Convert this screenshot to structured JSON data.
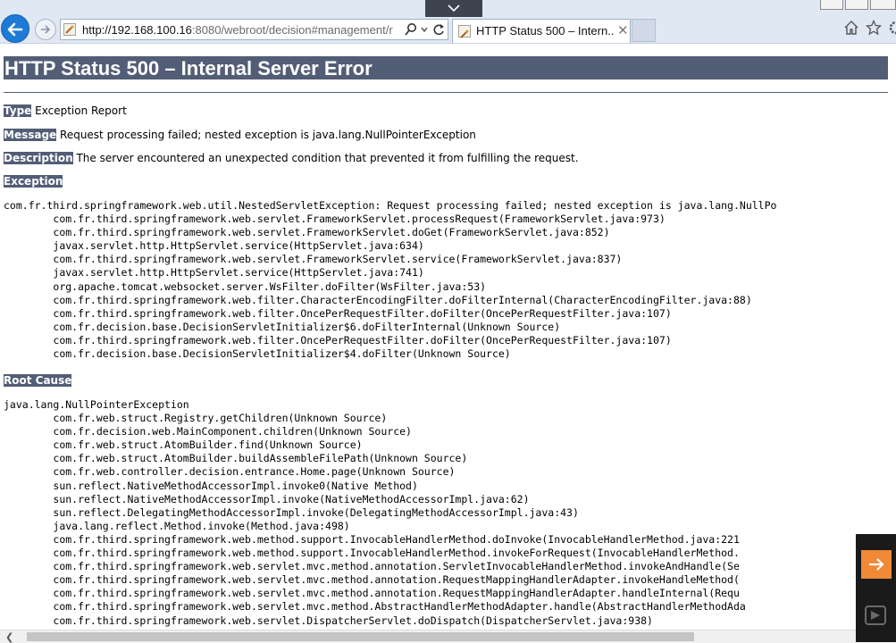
{
  "browser": {
    "url_host": "http://192.168.100.16",
    "url_rest": ":8080/webroot/decision#management/r",
    "tab_title": "HTTP Status 500 – Intern...",
    "tab_close": "✕"
  },
  "page": {
    "heading": "HTTP Status 500 – Internal Server Error",
    "type_label": "Type",
    "type_value": " Exception Report",
    "message_label": "Message",
    "message_value": " Request processing failed; nested exception is java.lang.NullPointerException",
    "description_label": "Description",
    "description_value": " The server encountered an unexpected condition that prevented it from fulfilling the request.",
    "exception_label": "Exception",
    "exception_trace": "com.fr.third.springframework.web.util.NestedServletException: Request processing failed; nested exception is java.lang.NullPo\n\tcom.fr.third.springframework.web.servlet.FrameworkServlet.processRequest(FrameworkServlet.java:973)\n\tcom.fr.third.springframework.web.servlet.FrameworkServlet.doGet(FrameworkServlet.java:852)\n\tjavax.servlet.http.HttpServlet.service(HttpServlet.java:634)\n\tcom.fr.third.springframework.web.servlet.FrameworkServlet.service(FrameworkServlet.java:837)\n\tjavax.servlet.http.HttpServlet.service(HttpServlet.java:741)\n\torg.apache.tomcat.websocket.server.WsFilter.doFilter(WsFilter.java:53)\n\tcom.fr.third.springframework.web.filter.CharacterEncodingFilter.doFilterInternal(CharacterEncodingFilter.java:88)\n\tcom.fr.third.springframework.web.filter.OncePerRequestFilter.doFilter(OncePerRequestFilter.java:107)\n\tcom.fr.decision.base.DecisionServletInitializer$6.doFilterInternal(Unknown Source)\n\tcom.fr.third.springframework.web.filter.OncePerRequestFilter.doFilter(OncePerRequestFilter.java:107)\n\tcom.fr.decision.base.DecisionServletInitializer$4.doFilter(Unknown Source)",
    "root_cause_label": "Root Cause",
    "root_cause_trace": "java.lang.NullPointerException\n\tcom.fr.web.struct.Registry.getChildren(Unknown Source)\n\tcom.fr.decision.web.MainComponent.children(Unknown Source)\n\tcom.fr.web.struct.AtomBuilder.find(Unknown Source)\n\tcom.fr.web.struct.AtomBuilder.buildAssembleFilePath(Unknown Source)\n\tcom.fr.web.controller.decision.entrance.Home.page(Unknown Source)\n\tsun.reflect.NativeMethodAccessorImpl.invoke0(Native Method)\n\tsun.reflect.NativeMethodAccessorImpl.invoke(NativeMethodAccessorImpl.java:62)\n\tsun.reflect.DelegatingMethodAccessorImpl.invoke(DelegatingMethodAccessorImpl.java:43)\n\tjava.lang.reflect.Method.invoke(Method.java:498)\n\tcom.fr.third.springframework.web.method.support.InvocableHandlerMethod.doInvoke(InvocableHandlerMethod.java:221\n\tcom.fr.third.springframework.web.method.support.InvocableHandlerMethod.invokeForRequest(InvocableHandlerMethod.\n\tcom.fr.third.springframework.web.servlet.mvc.method.annotation.ServletInvocableHandlerMethod.invokeAndHandle(Se\n\tcom.fr.third.springframework.web.servlet.mvc.method.annotation.RequestMappingHandlerAdapter.invokeHandleMethod(\n\tcom.fr.third.springframework.web.servlet.mvc.method.annotation.RequestMappingHandlerAdapter.handleInternal(Requ\n\tcom.fr.third.springframework.web.servlet.mvc.method.AbstractHandlerMethodAdapter.handle(AbstractHandlerMethodAda\n\tcom.fr.third.springframework.web.servlet.DispatcherServlet.doDispatch(DispatcherServlet.java:938)"
  },
  "icons": {
    "back": "back-arrow-icon",
    "forward": "forward-arrow-icon",
    "site": "site-favicon-icon",
    "search": "search-icon",
    "dropdown": "chevron-down-icon",
    "refresh": "refresh-icon",
    "home": "home-icon",
    "favorites": "star-icon",
    "settings": "gear-icon",
    "side_arrow": "arrow-right-icon"
  },
  "colors": {
    "heading_bg": "#525d76",
    "chrome_bg": "#dfe8f3",
    "back_button": "#1f7ad6",
    "side_button": "#f08a36"
  }
}
